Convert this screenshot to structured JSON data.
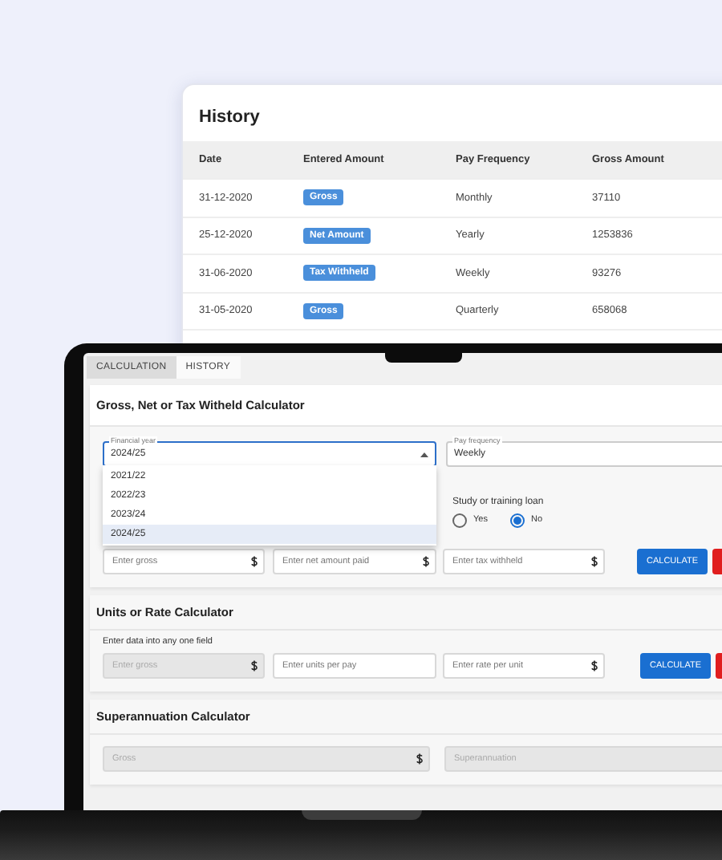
{
  "history": {
    "title": "History",
    "columns": [
      "Date",
      "Entered Amount",
      "Pay Frequency",
      "Gross Amount"
    ],
    "rows": [
      {
        "date": "31-12-2020",
        "entered_amount": "Gross",
        "pay_frequency": "Monthly",
        "gross_amount": "37110"
      },
      {
        "date": "25-12-2020",
        "entered_amount": "Net Amount",
        "pay_frequency": "Yearly",
        "gross_amount": "1253836"
      },
      {
        "date": "31-06-2020",
        "entered_amount": "Tax Withheld",
        "pay_frequency": "Weekly",
        "gross_amount": "93276"
      },
      {
        "date": "31-05-2020",
        "entered_amount": "Gross",
        "pay_frequency": "Quarterly",
        "gross_amount": "658068"
      }
    ]
  },
  "laptop": {
    "tabs": [
      {
        "label": "CALCULATION",
        "selected": true
      },
      {
        "label": "HISTORY",
        "selected": false
      }
    ],
    "gross_net_calculator": {
      "title": "Gross, Net or Tax Witheld Calculator",
      "financial_year": {
        "label": "Financial year",
        "value": "2024/25",
        "expanded": true,
        "options": [
          {
            "label": "2021/22",
            "selected": false
          },
          {
            "label": "2022/23",
            "selected": false
          },
          {
            "label": "2023/24",
            "selected": false
          },
          {
            "label": "2024/25",
            "selected": true
          }
        ]
      },
      "pay_frequency": {
        "label": "Pay frequency",
        "value": "Weekly"
      },
      "study_loan": {
        "label": "Study or training loan",
        "options": [
          {
            "label": "Yes",
            "selected": false
          },
          {
            "label": "No",
            "selected": true
          }
        ]
      },
      "fields": [
        {
          "placeholder": "Enter gross",
          "currency": true,
          "disabled": false
        },
        {
          "placeholder": "Enter net amount paid",
          "currency": true,
          "disabled": false
        },
        {
          "placeholder": "Enter tax withheld",
          "currency": true,
          "disabled": false
        }
      ],
      "calculate_button": "CALCULATE"
    },
    "units_rate_calculator": {
      "title": "Units or Rate Calculator",
      "hint": "Enter data into any one field",
      "fields": [
        {
          "placeholder": "Enter gross",
          "currency": true,
          "disabled": true
        },
        {
          "placeholder": "Enter units per pay",
          "currency": false,
          "disabled": false
        },
        {
          "placeholder": "Enter rate per unit",
          "currency": true,
          "disabled": false
        }
      ],
      "calculate_button": "CALCULATE"
    },
    "superannuation_calculator": {
      "title": "Superannuation Calculator",
      "fields": [
        {
          "placeholder": "Gross",
          "currency": true,
          "disabled": true
        },
        {
          "placeholder": "Superannuation",
          "currency": false,
          "disabled": true
        }
      ]
    }
  }
}
